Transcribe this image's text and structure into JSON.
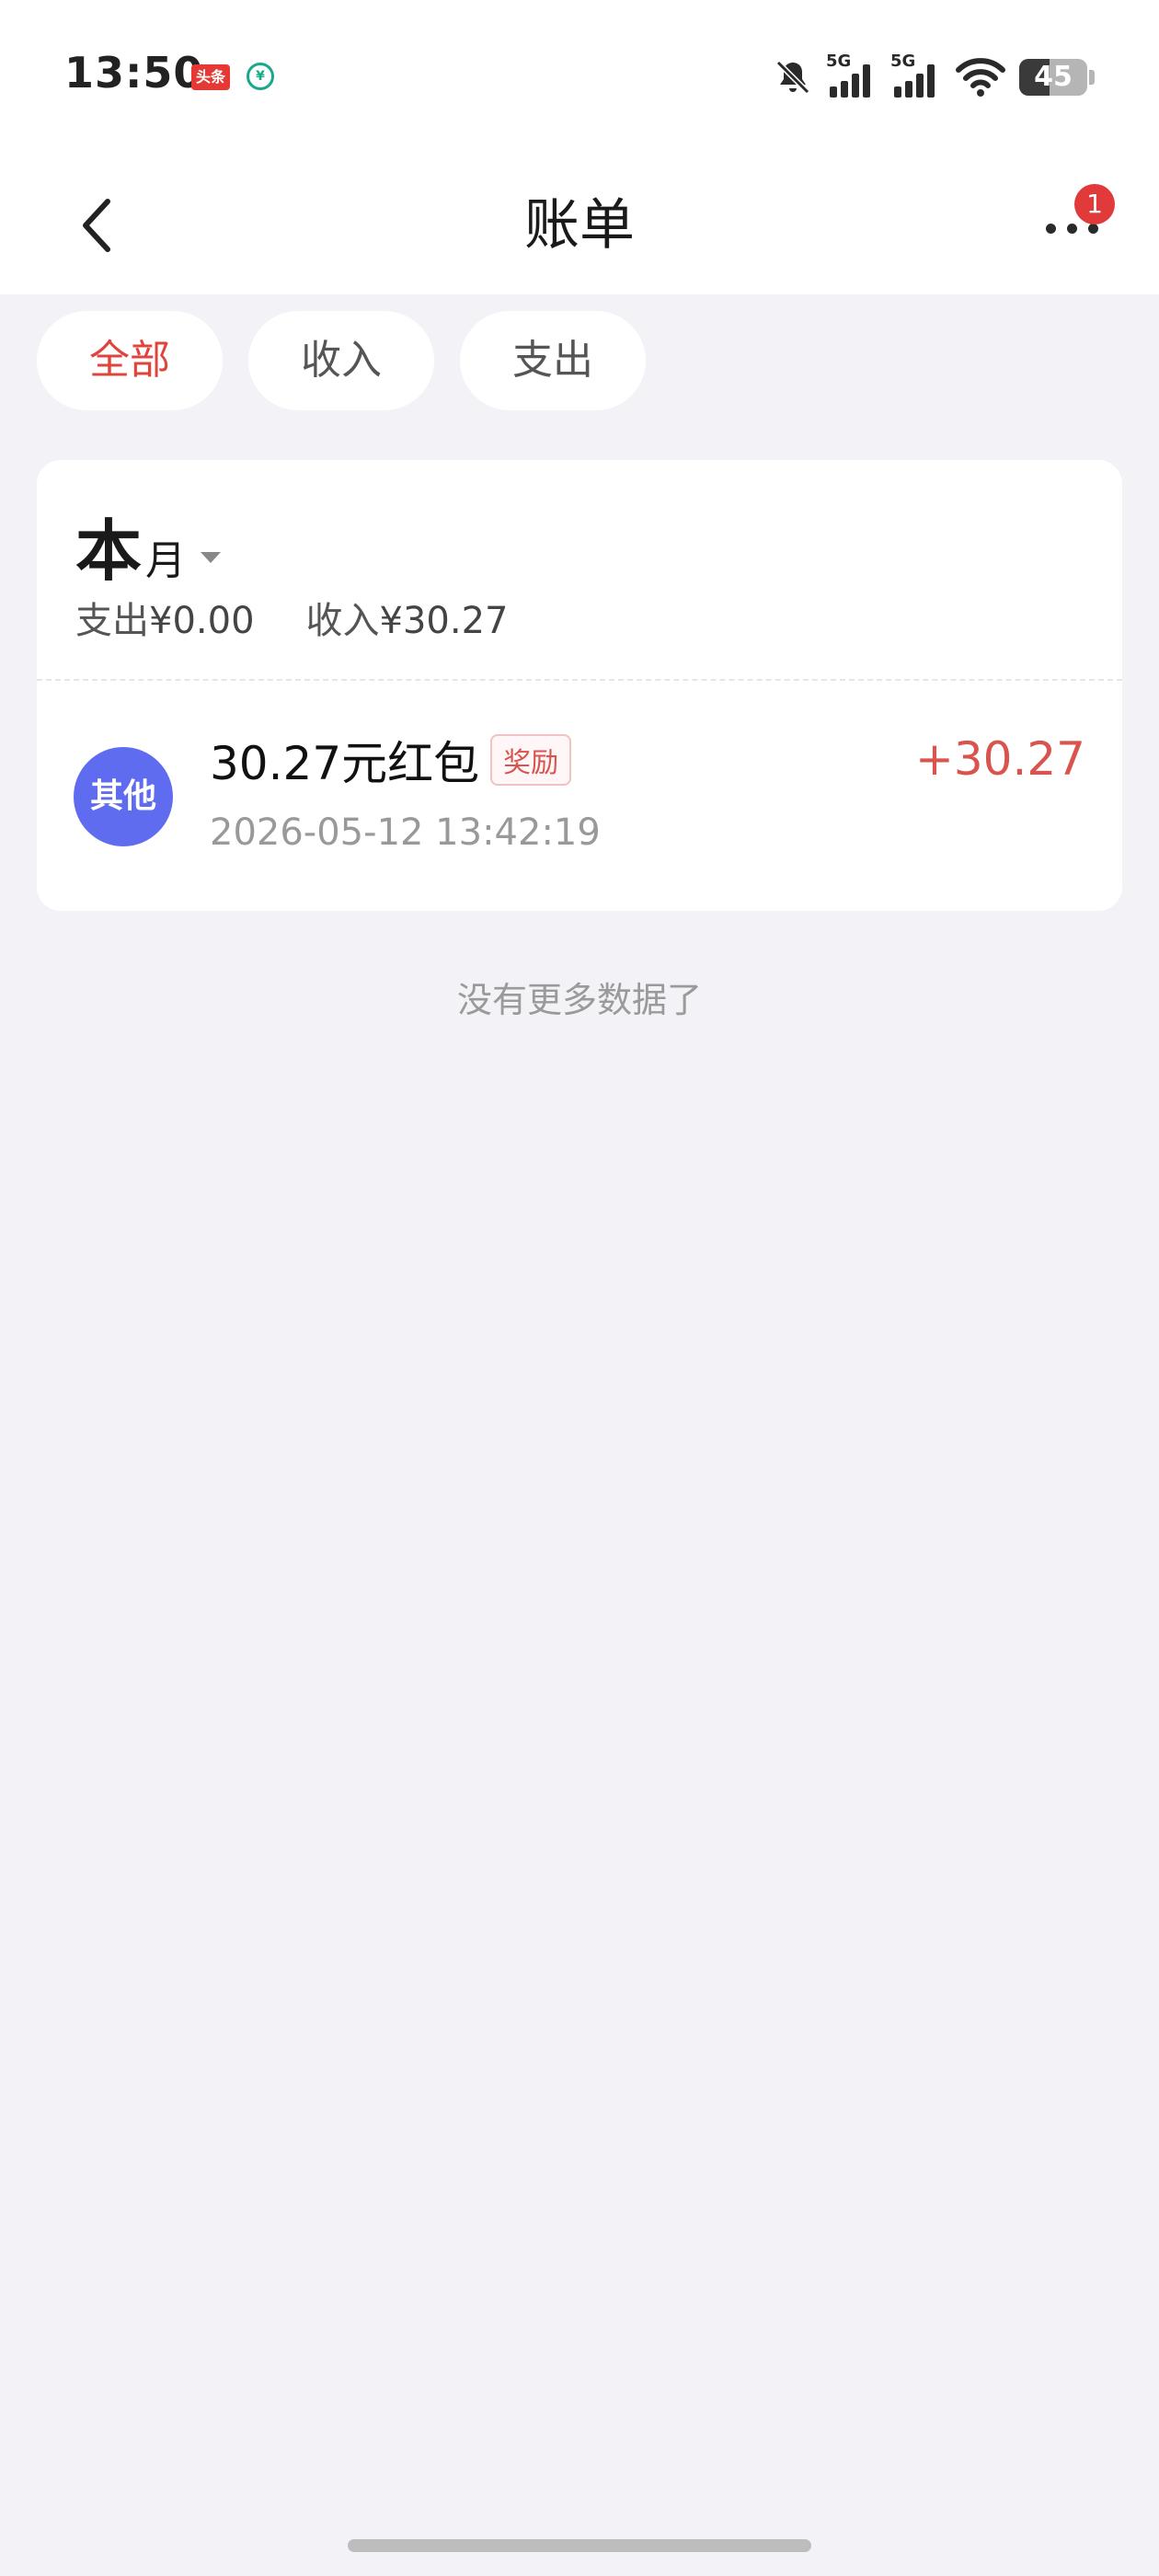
{
  "status_bar": {
    "time": "13:50",
    "app_icon_1_text": "头条",
    "app_icon_2_text": "¥",
    "signal_1_label": "5G",
    "signal_2_label": "5G",
    "battery_level": "45"
  },
  "nav": {
    "title": "账单",
    "more_badge": "1"
  },
  "filter_tabs": [
    {
      "label": "全部",
      "active": true
    },
    {
      "label": "收入",
      "active": false
    },
    {
      "label": "支出",
      "active": false
    }
  ],
  "summary": {
    "period_big": "本",
    "period_small": "月",
    "expense_label": "支出",
    "expense_amount": "¥0.00",
    "income_label": "收入",
    "income_amount": "¥30.27"
  },
  "transactions": [
    {
      "category": "其他",
      "title": "30.27元红包",
      "tag": "奖励",
      "time": "2026-05-12 13:42:19",
      "amount": "+30.27"
    }
  ],
  "footer": {
    "no_more": "没有更多数据了"
  },
  "colors": {
    "accent_red": "#e0453d",
    "avatar_blue": "#5f6cf0",
    "page_bg": "#f2f2f7"
  },
  "icons": [
    "back-arrow-icon",
    "more-dots-icon",
    "mute-bell-icon",
    "signal-icon",
    "wifi-icon",
    "battery-icon"
  ]
}
